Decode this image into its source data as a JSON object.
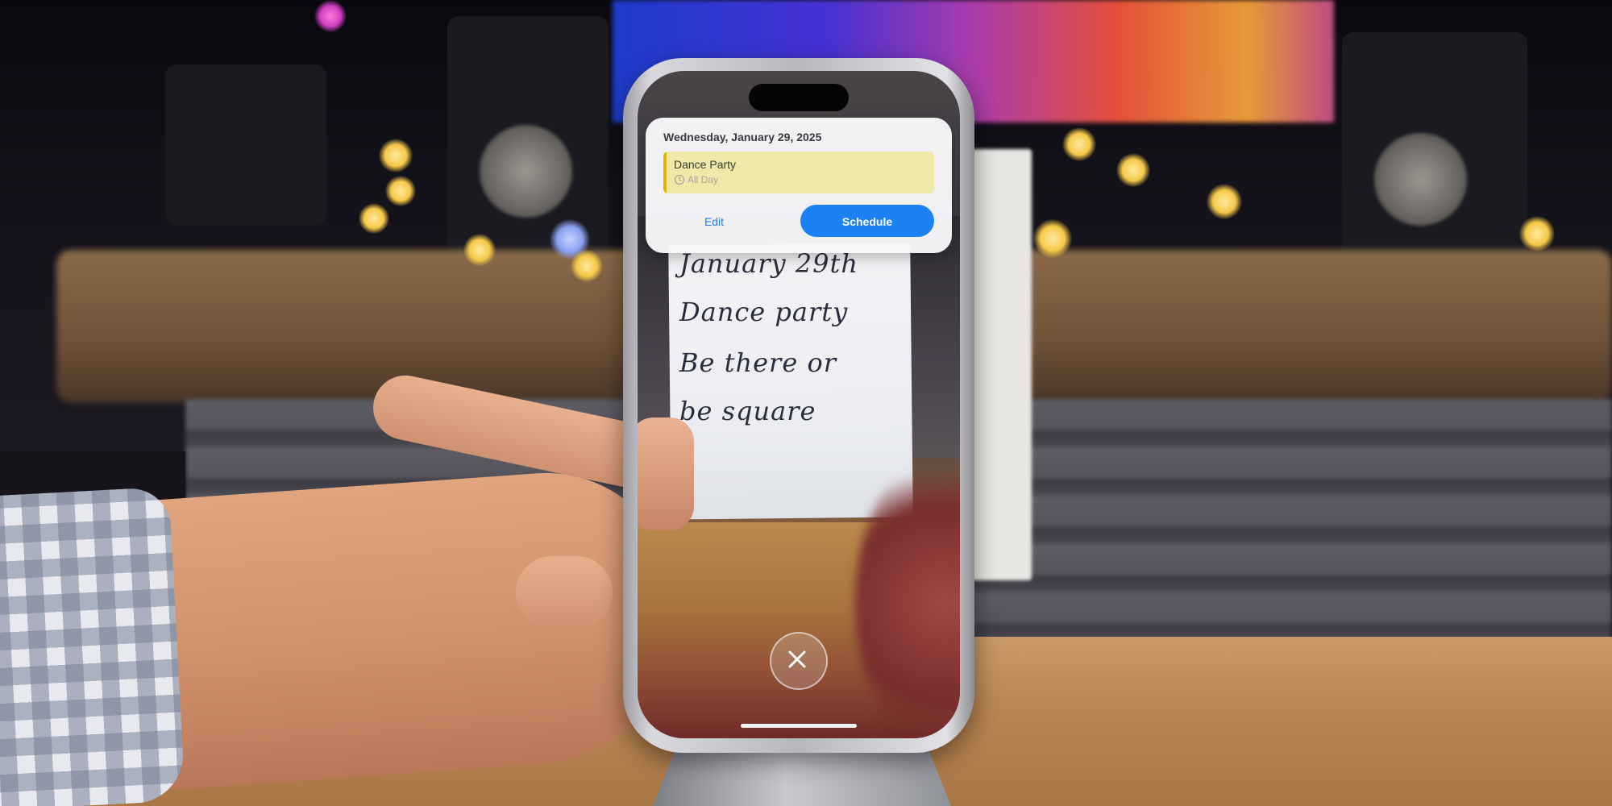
{
  "calendar_card": {
    "date": "Wednesday, January 29, 2025",
    "event_title": "Dance Party",
    "event_time": "All Day",
    "edit_label": "Edit",
    "schedule_label": "Schedule",
    "accent_color": "#1c81f2",
    "event_color": "#efe8a8"
  },
  "handwritten_note": {
    "line1": "January 29th",
    "line2": "Dance party",
    "line3": "Be there or",
    "line4": "be square"
  },
  "camera": {
    "close_icon": "close-icon"
  }
}
